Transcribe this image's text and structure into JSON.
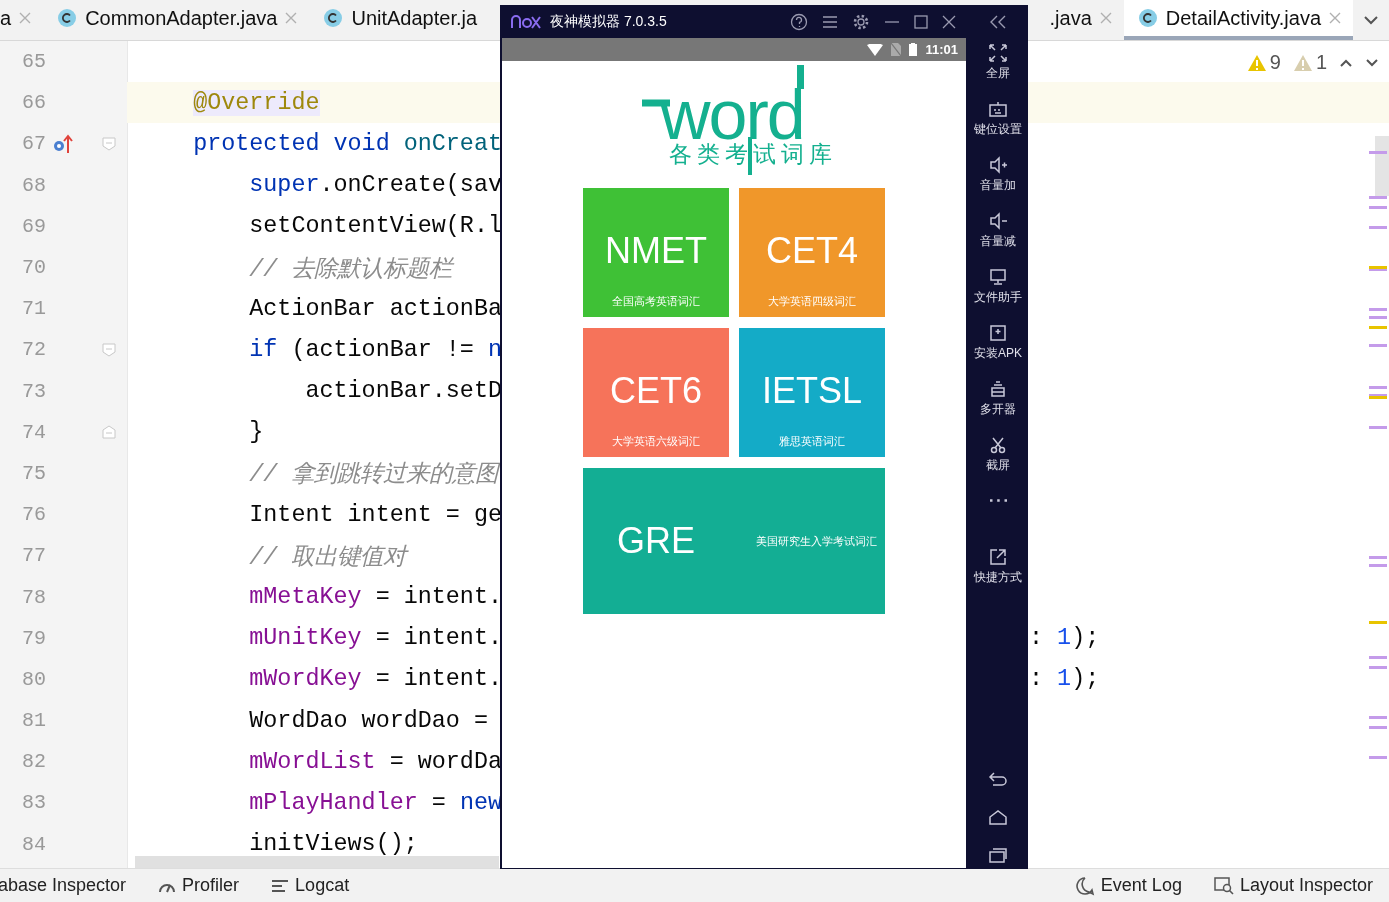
{
  "left_tabs": [
    {
      "label": "a",
      "selected": false,
      "icon": false,
      "closable": true
    },
    {
      "label": "CommonAdapter.java",
      "selected": false,
      "icon": true,
      "closable": true
    },
    {
      "label": "UnitAdapter.ja",
      "selected": false,
      "icon": true,
      "closable": false
    }
  ],
  "right_tabs": [
    {
      "label": ".java",
      "selected": false,
      "icon": false,
      "closable": true
    },
    {
      "label": "DetailActivity.java",
      "selected": true,
      "icon": true,
      "closable": true
    }
  ],
  "inspections": [
    {
      "kind": "warning",
      "count": "9"
    },
    {
      "kind": "weak",
      "count": "1"
    }
  ],
  "lines": [
    {
      "number": "65",
      "current": false
    },
    {
      "number": "66",
      "current": true,
      "tokens": [
        {
          "kind": "annotation",
          "text": "    @Override"
        }
      ]
    },
    {
      "number": "67",
      "current": false,
      "override": true,
      "fold_start": true,
      "tokens": [
        {
          "kind": "keyword",
          "text": "    protected void "
        },
        {
          "kind": "method",
          "text": "onCreat"
        }
      ]
    },
    {
      "number": "68",
      "current": false,
      "tokens": [
        {
          "kind": "keyword",
          "text": "        super"
        },
        {
          "kind": "plain",
          "text": ".onCreate(sav"
        }
      ]
    },
    {
      "number": "69",
      "current": false,
      "tokens": [
        {
          "kind": "plain",
          "text": "        setContentView(R.l"
        }
      ]
    },
    {
      "number": "70",
      "current": false,
      "tokens": [
        {
          "kind": "comment",
          "text": "        // 去除默认标题栏"
        }
      ]
    },
    {
      "number": "71",
      "current": false,
      "tokens": [
        {
          "kind": "plain",
          "text": "        ActionBar actionBa"
        }
      ]
    },
    {
      "number": "72",
      "current": false,
      "fold_start": true,
      "tokens": [
        {
          "kind": "keyword",
          "text": "        if"
        },
        {
          "kind": "plain",
          "text": " (actionBar != "
        },
        {
          "kind": "keyword",
          "text": "n"
        }
      ]
    },
    {
      "number": "73",
      "current": false,
      "tokens": [
        {
          "kind": "plain",
          "text": "            actionBar.setD"
        }
      ]
    },
    {
      "number": "74",
      "current": false,
      "fold_end": true,
      "tokens": [
        {
          "kind": "plain",
          "text": "        }"
        }
      ]
    },
    {
      "number": "75",
      "current": false,
      "tokens": [
        {
          "kind": "comment",
          "text": "        // 拿到跳转过来的意图"
        }
      ]
    },
    {
      "number": "76",
      "current": false,
      "tokens": [
        {
          "kind": "plain",
          "text": "        Intent intent = ge"
        }
      ]
    },
    {
      "number": "77",
      "current": false,
      "tokens": [
        {
          "kind": "comment",
          "text": "        // 取出键值对"
        }
      ]
    },
    {
      "number": "78",
      "current": false,
      "tokens": [
        {
          "kind": "field",
          "text": "        mMetaKey"
        },
        {
          "kind": "plain",
          "text": " = intent."
        }
      ]
    },
    {
      "number": "79",
      "current": false,
      "tokens": [
        {
          "kind": "field",
          "text": "        mUnitKey"
        },
        {
          "kind": "plain",
          "text": " = intent."
        }
      ],
      "tail": [
        {
          "kind": "plain",
          "text": ": "
        },
        {
          "kind": "number",
          "text": "1"
        },
        {
          "kind": "plain",
          "text": ");"
        }
      ]
    },
    {
      "number": "80",
      "current": false,
      "tokens": [
        {
          "kind": "field",
          "text": "        mWordKey"
        },
        {
          "kind": "plain",
          "text": " = intent."
        }
      ],
      "tail": [
        {
          "kind": "plain",
          "text": ": "
        },
        {
          "kind": "number",
          "text": "1"
        },
        {
          "kind": "plain",
          "text": ");"
        }
      ]
    },
    {
      "number": "81",
      "current": false,
      "tokens": [
        {
          "kind": "plain",
          "text": "        WordDao wordDao = "
        }
      ]
    },
    {
      "number": "82",
      "current": false,
      "tokens": [
        {
          "kind": "field",
          "text": "        mWordList"
        },
        {
          "kind": "plain",
          "text": " = wordDa"
        }
      ]
    },
    {
      "number": "83",
      "current": false,
      "tokens": [
        {
          "kind": "field",
          "text": "        mPlayHandler"
        },
        {
          "kind": "plain",
          "text": " = "
        },
        {
          "kind": "keyword",
          "text": "new"
        }
      ]
    },
    {
      "number": "84",
      "current": false,
      "tokens": [
        {
          "kind": "plain",
          "text": "        initViews();"
        }
      ]
    }
  ],
  "tool_windows_left": [
    {
      "kind": "database",
      "label": "abase Inspector"
    },
    {
      "kind": "profiler",
      "label": "Profiler"
    },
    {
      "kind": "logcat",
      "label": "Logcat"
    }
  ],
  "tool_windows_right": [
    {
      "kind": "eventlog",
      "label": "Event Log"
    },
    {
      "kind": "layout",
      "label": "Layout Inspector"
    }
  ],
  "emulator": {
    "title": "夜神模拟器 7.0.3.5",
    "time": "11:01",
    "logo": {
      "word": "word",
      "subtitle": "各类考试词库"
    },
    "tiles": [
      {
        "kind": "square",
        "title": "NMET",
        "subtitle": "全国高考英语词汇",
        "color": "#3fc136"
      },
      {
        "kind": "square",
        "title": "CET4",
        "subtitle": "大学英语四级词汇",
        "color": "#f0972a"
      },
      {
        "kind": "square",
        "title": "CET6",
        "subtitle": "大学英语六级词汇",
        "color": "#f6735a"
      },
      {
        "kind": "square",
        "title": "IETSL",
        "subtitle": "雅思英语词汇",
        "color": "#14abc7"
      },
      {
        "kind": "wide",
        "title": "GRE",
        "subtitle": "美国研究生入学考试词汇",
        "color": "#13ae94"
      }
    ],
    "tools": [
      {
        "kind": "fullscreen",
        "label": "全屏"
      },
      {
        "kind": "keymap",
        "label": "键位设置"
      },
      {
        "kind": "volup",
        "label": "音量加"
      },
      {
        "kind": "voldown",
        "label": "音量减"
      },
      {
        "kind": "files",
        "label": "文件助手"
      },
      {
        "kind": "apk",
        "label": "安装APK"
      },
      {
        "kind": "multi",
        "label": "多开器"
      },
      {
        "kind": "screenshot",
        "label": "截屏"
      },
      {
        "kind": "more"
      },
      {
        "kind": "shortcut",
        "label": "快捷方式"
      }
    ]
  }
}
